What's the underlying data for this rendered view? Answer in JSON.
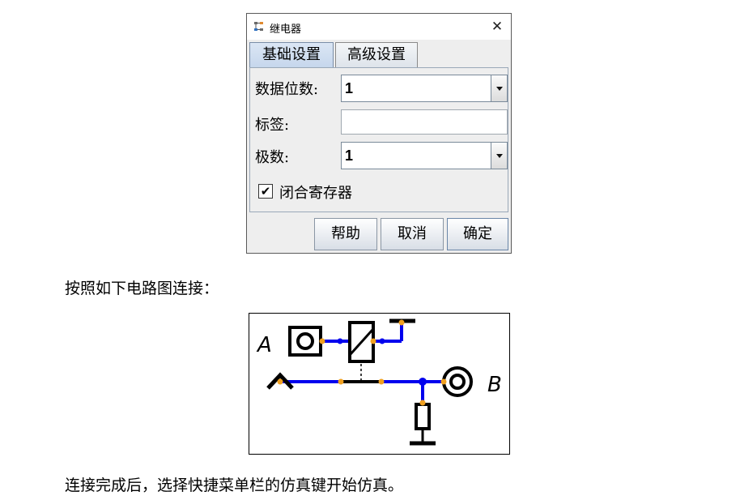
{
  "dialog": {
    "title": "继电器",
    "tabs": [
      {
        "label": "基础设置",
        "active": true
      },
      {
        "label": "高级设置",
        "active": false
      }
    ],
    "fields": {
      "data_bits_label": "数据位数:",
      "data_bits_value": "1",
      "tag_label": "标签:",
      "tag_value": "",
      "poles_label": "极数:",
      "poles_value": "1"
    },
    "checkbox": {
      "label": "闭合寄存器",
      "checked": true,
      "mark": "✔"
    },
    "buttons": {
      "help": "帮助",
      "cancel": "取消",
      "ok": "确定"
    },
    "close_glyph": "✕"
  },
  "text": {
    "instruction": "按照如下电路图连接：",
    "conclusion": "连接完成后，选择快捷菜单栏的仿真键开始仿真。"
  },
  "circuit": {
    "label_a": "A",
    "label_b": "B",
    "colors": {
      "wire": "#0000ee",
      "pin": "#f0a020",
      "component": "#000000"
    }
  }
}
